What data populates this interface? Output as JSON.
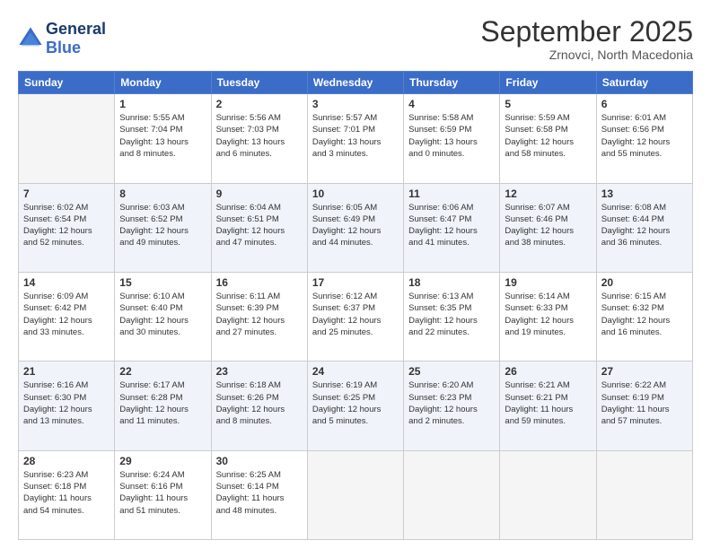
{
  "header": {
    "logo_line1": "General",
    "logo_line2": "Blue",
    "month": "September 2025",
    "location": "Zrnovci, North Macedonia"
  },
  "weekdays": [
    "Sunday",
    "Monday",
    "Tuesday",
    "Wednesday",
    "Thursday",
    "Friday",
    "Saturday"
  ],
  "weeks": [
    [
      {
        "day": "",
        "info": ""
      },
      {
        "day": "1",
        "info": "Sunrise: 5:55 AM\nSunset: 7:04 PM\nDaylight: 13 hours\nand 8 minutes."
      },
      {
        "day": "2",
        "info": "Sunrise: 5:56 AM\nSunset: 7:03 PM\nDaylight: 13 hours\nand 6 minutes."
      },
      {
        "day": "3",
        "info": "Sunrise: 5:57 AM\nSunset: 7:01 PM\nDaylight: 13 hours\nand 3 minutes."
      },
      {
        "day": "4",
        "info": "Sunrise: 5:58 AM\nSunset: 6:59 PM\nDaylight: 13 hours\nand 0 minutes."
      },
      {
        "day": "5",
        "info": "Sunrise: 5:59 AM\nSunset: 6:58 PM\nDaylight: 12 hours\nand 58 minutes."
      },
      {
        "day": "6",
        "info": "Sunrise: 6:01 AM\nSunset: 6:56 PM\nDaylight: 12 hours\nand 55 minutes."
      }
    ],
    [
      {
        "day": "7",
        "info": "Sunrise: 6:02 AM\nSunset: 6:54 PM\nDaylight: 12 hours\nand 52 minutes."
      },
      {
        "day": "8",
        "info": "Sunrise: 6:03 AM\nSunset: 6:52 PM\nDaylight: 12 hours\nand 49 minutes."
      },
      {
        "day": "9",
        "info": "Sunrise: 6:04 AM\nSunset: 6:51 PM\nDaylight: 12 hours\nand 47 minutes."
      },
      {
        "day": "10",
        "info": "Sunrise: 6:05 AM\nSunset: 6:49 PM\nDaylight: 12 hours\nand 44 minutes."
      },
      {
        "day": "11",
        "info": "Sunrise: 6:06 AM\nSunset: 6:47 PM\nDaylight: 12 hours\nand 41 minutes."
      },
      {
        "day": "12",
        "info": "Sunrise: 6:07 AM\nSunset: 6:46 PM\nDaylight: 12 hours\nand 38 minutes."
      },
      {
        "day": "13",
        "info": "Sunrise: 6:08 AM\nSunset: 6:44 PM\nDaylight: 12 hours\nand 36 minutes."
      }
    ],
    [
      {
        "day": "14",
        "info": "Sunrise: 6:09 AM\nSunset: 6:42 PM\nDaylight: 12 hours\nand 33 minutes."
      },
      {
        "day": "15",
        "info": "Sunrise: 6:10 AM\nSunset: 6:40 PM\nDaylight: 12 hours\nand 30 minutes."
      },
      {
        "day": "16",
        "info": "Sunrise: 6:11 AM\nSunset: 6:39 PM\nDaylight: 12 hours\nand 27 minutes."
      },
      {
        "day": "17",
        "info": "Sunrise: 6:12 AM\nSunset: 6:37 PM\nDaylight: 12 hours\nand 25 minutes."
      },
      {
        "day": "18",
        "info": "Sunrise: 6:13 AM\nSunset: 6:35 PM\nDaylight: 12 hours\nand 22 minutes."
      },
      {
        "day": "19",
        "info": "Sunrise: 6:14 AM\nSunset: 6:33 PM\nDaylight: 12 hours\nand 19 minutes."
      },
      {
        "day": "20",
        "info": "Sunrise: 6:15 AM\nSunset: 6:32 PM\nDaylight: 12 hours\nand 16 minutes."
      }
    ],
    [
      {
        "day": "21",
        "info": "Sunrise: 6:16 AM\nSunset: 6:30 PM\nDaylight: 12 hours\nand 13 minutes."
      },
      {
        "day": "22",
        "info": "Sunrise: 6:17 AM\nSunset: 6:28 PM\nDaylight: 12 hours\nand 11 minutes."
      },
      {
        "day": "23",
        "info": "Sunrise: 6:18 AM\nSunset: 6:26 PM\nDaylight: 12 hours\nand 8 minutes."
      },
      {
        "day": "24",
        "info": "Sunrise: 6:19 AM\nSunset: 6:25 PM\nDaylight: 12 hours\nand 5 minutes."
      },
      {
        "day": "25",
        "info": "Sunrise: 6:20 AM\nSunset: 6:23 PM\nDaylight: 12 hours\nand 2 minutes."
      },
      {
        "day": "26",
        "info": "Sunrise: 6:21 AM\nSunset: 6:21 PM\nDaylight: 11 hours\nand 59 minutes."
      },
      {
        "day": "27",
        "info": "Sunrise: 6:22 AM\nSunset: 6:19 PM\nDaylight: 11 hours\nand 57 minutes."
      }
    ],
    [
      {
        "day": "28",
        "info": "Sunrise: 6:23 AM\nSunset: 6:18 PM\nDaylight: 11 hours\nand 54 minutes."
      },
      {
        "day": "29",
        "info": "Sunrise: 6:24 AM\nSunset: 6:16 PM\nDaylight: 11 hours\nand 51 minutes."
      },
      {
        "day": "30",
        "info": "Sunrise: 6:25 AM\nSunset: 6:14 PM\nDaylight: 11 hours\nand 48 minutes."
      },
      {
        "day": "",
        "info": ""
      },
      {
        "day": "",
        "info": ""
      },
      {
        "day": "",
        "info": ""
      },
      {
        "day": "",
        "info": ""
      }
    ]
  ]
}
